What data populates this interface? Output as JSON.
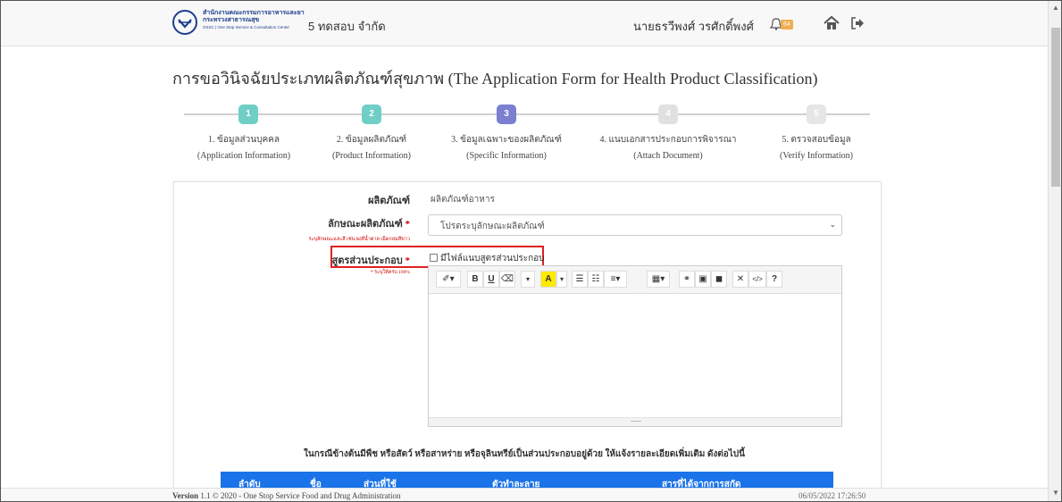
{
  "header": {
    "logo_line1": "สำนักงานคณะกรรมการอาหารและยา",
    "logo_line2": "กระทรวงสาธารณสุข",
    "logo_line3": "OSSC | One Stop Service & Consultation Center",
    "company": "5 ทดสอบ จำกัด",
    "user": "นายธรวีพงศ์ วรศักดิ์พงศ์",
    "notification_count": "64",
    "icons": [
      "bell-icon",
      "home-icon",
      "logout-icon"
    ]
  },
  "page": {
    "title": "การขอวินิจฉัยประเภทผลิตภัณฑ์สุขภาพ (The Application Form for Health Product Classification)"
  },
  "stepper": {
    "steps": [
      {
        "number": "1",
        "label_th": "1. ข้อมูลส่วนบุคคล",
        "label_en": "(Application Information)",
        "color": "#6fcfc6"
      },
      {
        "number": "2",
        "label_th": "2. ข้อมูลผลิตภัณฑ์",
        "label_en": "(Product Information)",
        "color": "#6fcfc6"
      },
      {
        "number": "3",
        "label_th": "3. ข้อมูลเฉพาะของผลิตภัณฑ์",
        "label_en": "(Specific Information)",
        "color": "#7b7fd0"
      },
      {
        "number": "4",
        "label_th": "4. แนบเอกสารประกอบการพิจารณา",
        "label_en": "(Attach Document)",
        "color": "#e0e0e0"
      },
      {
        "number": "5",
        "label_th": "5. ตรวจสอบข้อมูล",
        "label_en": "(Verify Information)",
        "color": "#e6e6e6"
      }
    ]
  },
  "form": {
    "product_label": "ผลิตภัณฑ์",
    "product_value": "ผลิตภัณฑ์อาหาร",
    "characteristic_label": "ลักษณะผลิตภัณฑ์",
    "characteristic_hint": "ระบุลักษณะและสี เช่น ผงสีน้ำตาล เม็ดกลมสีขาว",
    "characteristic_select": "โปรดระบุลักษณะผลิตภัณฑ์",
    "formula_label": "สูตรส่วนประกอบ",
    "formula_hint": "* ระบุให้ครบ 100%",
    "required_mark": "*",
    "attach_checkbox_label": "มีไฟล์แนบสูตรส่วนประกอบ",
    "attach_checked": false
  },
  "editor": {
    "toolbar": {
      "magic": "✐▾",
      "bold": "B",
      "underline": "U",
      "eraser": "⌫",
      "font_dropdown": "▾",
      "color": "A",
      "color_dropdown": "▾",
      "ul": "☰",
      "ol": "☷",
      "align": "≡▾",
      "table": "▦▾",
      "link": "⚭",
      "image": "▣",
      "video": "◼",
      "fullscreen": "✕",
      "code": "</>",
      "help": "?"
    }
  },
  "note": "ในกรณีข้างต้นมีพืช หรือสัตว์ หรือสาหร่าย หรือจุลินทรีย์เป็นส่วนประกอบอยู่ด้วย ให้แจ้งรายละเอียดเพิ่มเติม ดังต่อไปนี้",
  "table": {
    "headers": [
      "ลำดับ",
      "ชื่อ",
      "ส่วนที่ใช้",
      "ตัวทำละลาย",
      "สารที่ได้จากการสกัด"
    ],
    "header_color": "#1a73e8"
  },
  "footer": {
    "version_label": "Version",
    "version_text": "1.1 © 2020 - One Stop Service Food and Drug Administration",
    "datetime": "06/05/2022 17:26:50"
  }
}
